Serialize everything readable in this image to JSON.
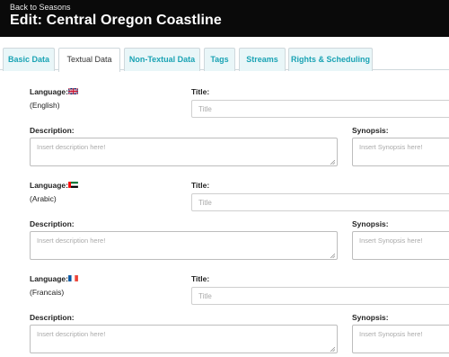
{
  "header": {
    "back_link": "Back to Seasons",
    "title": "Edit: Central Oregon Coastline"
  },
  "tabs": [
    {
      "label": "Basic Data",
      "active": false
    },
    {
      "label": "Textual Data",
      "active": true
    },
    {
      "label": "Non-Textual Data",
      "active": false
    },
    {
      "label": "Tags",
      "active": false
    },
    {
      "label": "Streams",
      "active": false
    },
    {
      "label": "Rights & Scheduling",
      "active": false
    }
  ],
  "form": {
    "language_label": "Language:",
    "title_label": "Title:",
    "title_placeholder": "Title",
    "description_label": "Description:",
    "description_placeholder": "Insert description here!",
    "synopsis_label": "Synopsis:",
    "synopsis_placeholder": "Insert Synopsis here!"
  },
  "languages": [
    {
      "name": "(English)",
      "flag_icon": "uk-flag-icon"
    },
    {
      "name": "(Arabic)",
      "flag_icon": "uae-flag-icon"
    },
    {
      "name": "(Francais)",
      "flag_icon": "france-flag-icon"
    }
  ],
  "colors": {
    "header_bg": "#0a0a0a",
    "tab_bg": "#e9f6f8",
    "tab_text": "#1aa3b4"
  }
}
